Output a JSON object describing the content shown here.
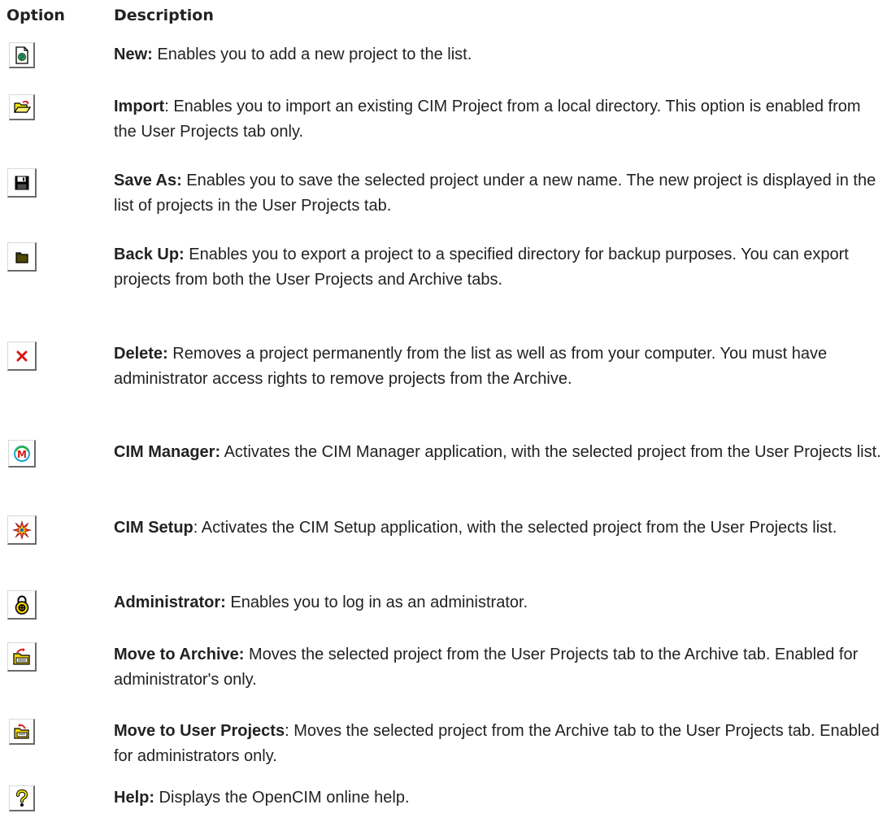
{
  "table": {
    "header_option": "Option",
    "header_description": "Description"
  },
  "options": [
    {
      "icon": "new-project-icon",
      "label": "New:",
      "text": " Enables you to add a new project to the list."
    },
    {
      "icon": "open-folder-icon",
      "label": "Import",
      "text": ": Enables you to import an existing CIM Project from a local directory. This option is enabled from the User Projects tab only."
    },
    {
      "icon": "floppy-disk-icon",
      "label": "Save As:",
      "text": " Enables you to save the selected project under a new name. The new project is displayed in the list of projects in the User Projects tab."
    },
    {
      "icon": "backup-folder-icon",
      "label": "Back Up:",
      "text": " Enables you to export a project to a specified directory for backup purposes. You can export projects from both the User Projects and Archive tabs."
    },
    {
      "icon": "delete-x-icon",
      "label": "Delete:",
      "text": " Removes a project permanently from the list as well as from your computer. You must have administrator access rights to remove projects from the Archive."
    },
    {
      "icon": "cim-manager-icon",
      "label": "CIM Manager:",
      "text": " Activates the CIM Manager application, with the selected project from the User Projects list."
    },
    {
      "icon": "cim-setup-icon",
      "label": "CIM Setup",
      "text": ": Activates the CIM Setup application, with the selected project from the User Projects list."
    },
    {
      "icon": "administrator-lock-icon",
      "label": "Administrator:",
      "text": " Enables you to log in as an administrator."
    },
    {
      "icon": "move-to-archive-icon",
      "label": "Move to Archive:",
      "text": " Moves the selected project from the User Projects tab to the Archive tab. Enabled for administrator's only."
    },
    {
      "icon": "move-to-user-projects-icon",
      "label": "Move to User Projects",
      "text": ": Moves the selected project from the Archive tab to the User Projects tab. Enabled for administrators only."
    },
    {
      "icon": "help-question-icon",
      "label": "Help:",
      "text": " Displays the OpenCIM online help."
    }
  ]
}
